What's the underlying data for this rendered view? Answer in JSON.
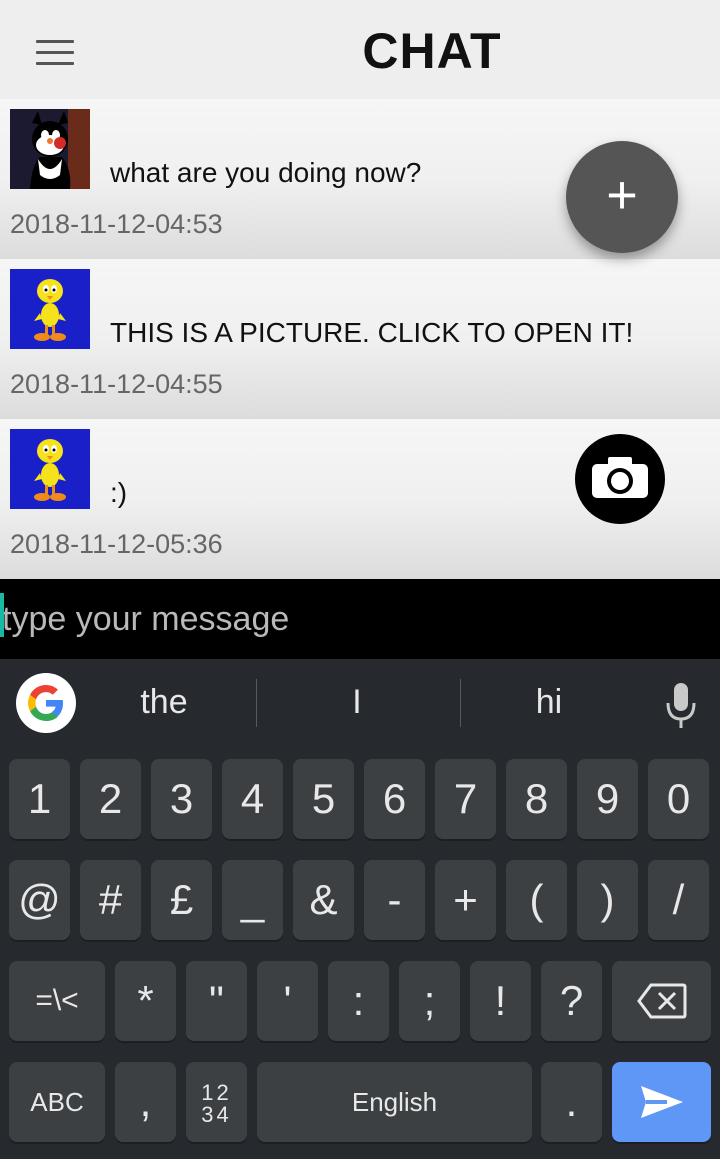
{
  "header": {
    "title": "CHAT",
    "menu_icon": "hamburger-menu-icon"
  },
  "messages": [
    {
      "avatar": "sylvester-avatar",
      "text": "what are you doing now?",
      "time": "2018-11-12-04:53",
      "has_picture": false
    },
    {
      "avatar": "tweety-avatar",
      "text": "THIS IS A PICTURE. CLICK TO OPEN IT!",
      "time": "2018-11-12-04:55",
      "has_picture": false
    },
    {
      "avatar": "tweety-avatar",
      "text": ":)",
      "time": "2018-11-12-05:36",
      "has_picture": true
    }
  ],
  "fab": {
    "label": "+"
  },
  "composer": {
    "placeholder": "type your message",
    "value": ""
  },
  "keyboard": {
    "suggestions": [
      "the",
      "I",
      "hi"
    ],
    "row1": [
      "1",
      "2",
      "3",
      "4",
      "5",
      "6",
      "7",
      "8",
      "9",
      "0"
    ],
    "row2": [
      "@",
      "#",
      "£",
      "_",
      "&",
      "-",
      "+",
      "(",
      ")",
      "/"
    ],
    "row3": [
      "=\\<",
      "*",
      "\"",
      "'",
      ":",
      ";",
      "!",
      "?"
    ],
    "row4": {
      "abc": "ABC",
      "comma": ",",
      "numpad_top": "12",
      "numpad_bottom": "34",
      "space": "English",
      "period": "."
    }
  },
  "colors": {
    "fab": "#555555",
    "send_key": "#5e97f6",
    "cursor": "#17b9a3",
    "keyboard_bg": "#262a2f"
  }
}
